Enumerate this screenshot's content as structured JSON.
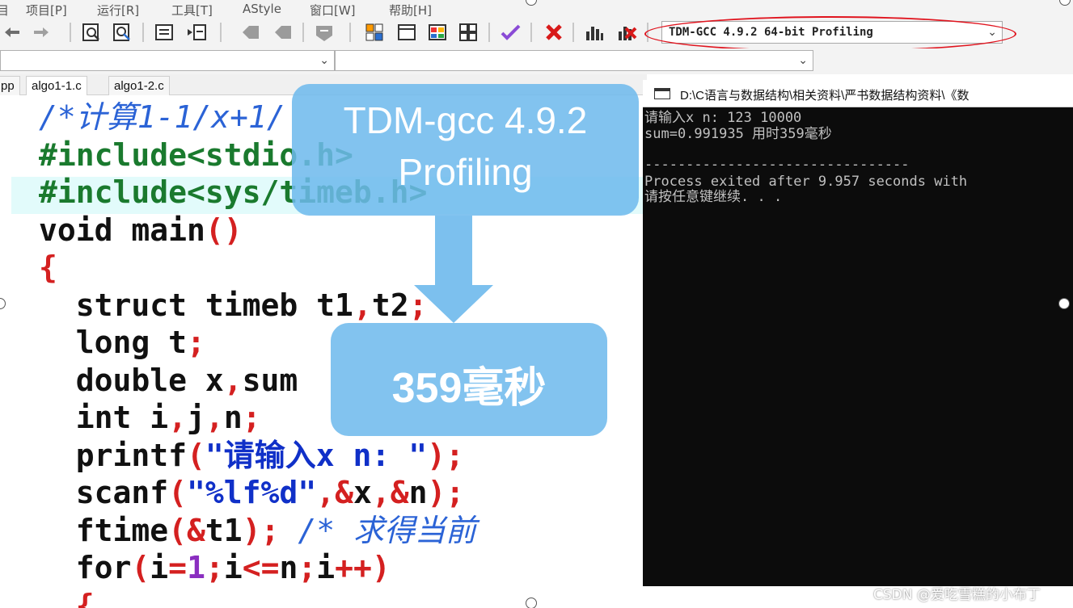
{
  "menubar": {
    "items": [
      "目",
      "项目[P]",
      "运行[R]",
      "工具[T]",
      "AStyle",
      "窗口[W]",
      "帮助[H]"
    ]
  },
  "toolbar": {
    "compiler": "TDM-GCC 4.9.2 64-bit Profiling",
    "icons": [
      "undo-icon",
      "redo-icon",
      "find-icon",
      "replace-icon",
      "indent-icon",
      "unindent-icon",
      "bookmark-icon",
      "bookmark-prev-icon",
      "comment-icon",
      "new-project-icon",
      "window-icon",
      "color-icon",
      "grid-icon",
      "check-icon",
      "delete-icon",
      "chart-icon",
      "delete-chart-icon"
    ]
  },
  "tabs": [
    "pp",
    "algo1-1.c",
    "algo1-2.c"
  ],
  "editor": {
    "lines": [
      [
        {
          "t": "/*计算1-1/x+1/",
          "c": "cm"
        }
      ],
      [
        {
          "t": "#include<stdio.h>",
          "c": "pp"
        }
      ],
      [
        {
          "t": "#include<sys/timeb.h>",
          "c": "pp"
        }
      ],
      [
        {
          "t": "void main",
          "c": "kw"
        },
        {
          "t": "()",
          "c": "rd"
        }
      ],
      [
        {
          "t": "{",
          "c": "rd"
        }
      ],
      [
        {
          "t": "  struct timeb t1",
          "c": "kw"
        },
        {
          "t": ",",
          "c": "rd"
        },
        {
          "t": "t2",
          "c": "kw"
        },
        {
          "t": ";",
          "c": "rd"
        }
      ],
      [
        {
          "t": "  long t",
          "c": "kw"
        },
        {
          "t": ";",
          "c": "rd"
        }
      ],
      [
        {
          "t": "  double x",
          "c": "kw"
        },
        {
          "t": ",",
          "c": "rd"
        },
        {
          "t": "sum",
          "c": "kw"
        }
      ],
      [
        {
          "t": "  int i",
          "c": "kw"
        },
        {
          "t": ",",
          "c": "rd"
        },
        {
          "t": "j",
          "c": "kw"
        },
        {
          "t": ",",
          "c": "rd"
        },
        {
          "t": "n",
          "c": "kw"
        },
        {
          "t": ";",
          "c": "rd"
        }
      ],
      [
        {
          "t": "  printf",
          "c": "kw"
        },
        {
          "t": "(",
          "c": "rd"
        },
        {
          "t": "\"请输入x n: \"",
          "c": "st"
        },
        {
          "t": ");",
          "c": "rd"
        }
      ],
      [
        {
          "t": "  scanf",
          "c": "kw"
        },
        {
          "t": "(",
          "c": "rd"
        },
        {
          "t": "\"%lf%d\"",
          "c": "st"
        },
        {
          "t": ",&",
          "c": "rd"
        },
        {
          "t": "x",
          "c": "kw"
        },
        {
          "t": ",&",
          "c": "rd"
        },
        {
          "t": "n",
          "c": "kw"
        },
        {
          "t": ");",
          "c": "rd"
        }
      ],
      [
        {
          "t": "  ftime",
          "c": "kw"
        },
        {
          "t": "(&",
          "c": "rd"
        },
        {
          "t": "t1",
          "c": "kw"
        },
        {
          "t": ");",
          "c": "rd"
        },
        {
          "t": " /* 求得当前",
          "c": "cm"
        }
      ],
      [
        {
          "t": "  for",
          "c": "kw"
        },
        {
          "t": "(",
          "c": "rd"
        },
        {
          "t": "i",
          "c": "kw"
        },
        {
          "t": "=",
          "c": "rd"
        },
        {
          "t": "1",
          "c": "nm"
        },
        {
          "t": ";",
          "c": "rd"
        },
        {
          "t": "i",
          "c": "kw"
        },
        {
          "t": "<=",
          "c": "rd"
        },
        {
          "t": "n",
          "c": "kw"
        },
        {
          "t": ";",
          "c": "rd"
        },
        {
          "t": "i",
          "c": "kw"
        },
        {
          "t": "++)",
          "c": "rd"
        }
      ],
      [
        {
          "t": "  {",
          "c": "rd"
        }
      ]
    ]
  },
  "console": {
    "title": "D:\\C语言与数据结构\\相关资料\\严书数据结构资料\\《数",
    "lines": [
      "请输入x n: 123 10000",
      "sum=0.991935 用时359毫秒",
      "",
      "--------------------------------",
      "Process exited after 9.957 seconds with",
      "请按任意键继续. . ."
    ]
  },
  "callouts": {
    "top_line1": "TDM-gcc 4.9.2",
    "top_line2": "Profiling",
    "bottom": "359毫秒"
  },
  "watermark": "CSDN @爱吃雪糕的小布丁"
}
